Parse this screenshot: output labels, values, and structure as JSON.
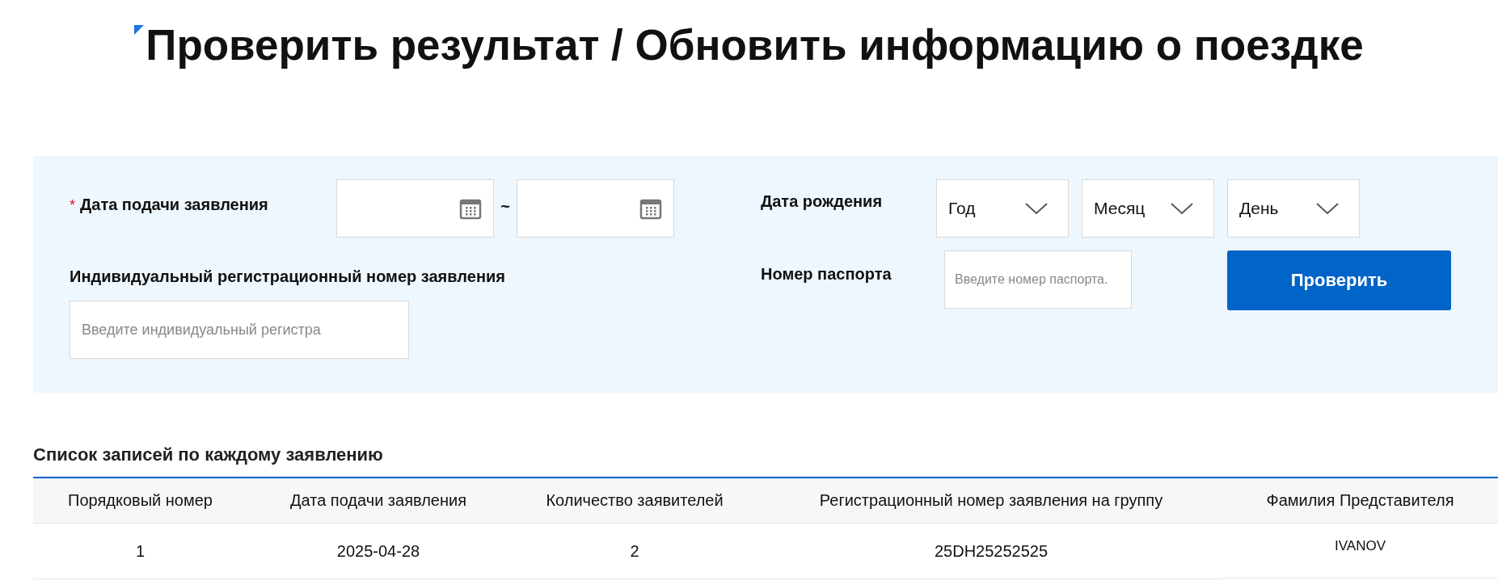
{
  "page": {
    "title": "Проверить результат / Обновить информацию о поездке"
  },
  "search_form": {
    "application_date": {
      "required_mark": "*",
      "label": "Дата подачи заявления",
      "separator": "~"
    },
    "individual_number": {
      "label": "Индивидуальный регистрационный номер заявления",
      "placeholder": "Введите индивидуальный регистра"
    },
    "birth_date": {
      "label": "Дата рождения",
      "selects": [
        {
          "value": "Год"
        },
        {
          "value": "Месяц"
        },
        {
          "value": "День"
        }
      ]
    },
    "passport": {
      "label": "Номер паспорта",
      "placeholder": "Введите номер паспорта."
    },
    "submit": "Проверить"
  },
  "results": {
    "title": "Список записей по каждому заявлению",
    "columns": [
      "Порядковый номер",
      "Дата подачи заявления",
      "Количество заявителей",
      "Регистрационный номер заявления на группу",
      "Фамилия Представителя"
    ],
    "rows": [
      [
        "1",
        "2025-04-28",
        "2",
        "25DH25252525",
        "IVANOV"
      ]
    ]
  }
}
